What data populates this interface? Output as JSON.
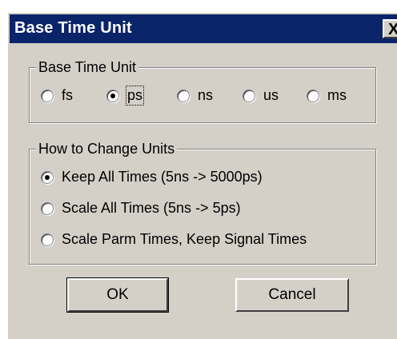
{
  "window": {
    "title": "Base Time Unit",
    "close_glyph": "X"
  },
  "base_unit_group": {
    "label": "Base Time Unit",
    "options": [
      {
        "label": "fs",
        "checked": false
      },
      {
        "label": "ps",
        "checked": true
      },
      {
        "label": "ns",
        "checked": false
      },
      {
        "label": "us",
        "checked": false
      },
      {
        "label": "ms",
        "checked": false
      }
    ]
  },
  "change_group": {
    "label": "How to Change Units",
    "options": [
      {
        "label": "Keep All Times (5ns -> 5000ps)",
        "checked": true
      },
      {
        "label": "Scale All Times (5ns -> 5ps)",
        "checked": false
      },
      {
        "label": "Scale Parm Times, Keep Signal Times",
        "checked": false
      }
    ]
  },
  "buttons": {
    "ok_label": "OK",
    "cancel_label": "Cancel"
  }
}
